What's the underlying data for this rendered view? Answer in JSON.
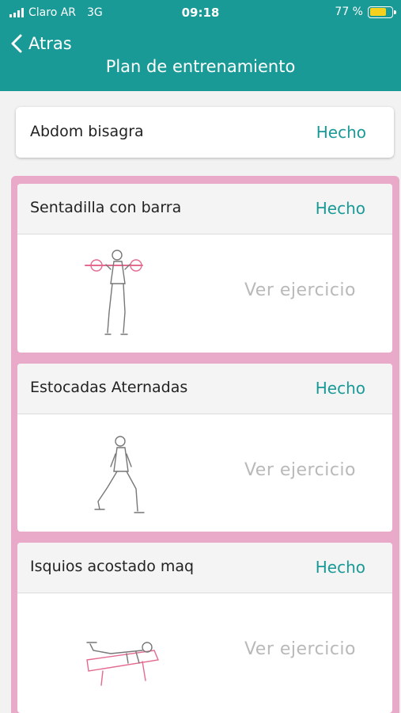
{
  "status_bar": {
    "carrier": "Claro AR",
    "network": "3G",
    "time": "09:18",
    "battery": "77 %",
    "battery_level": 0.77
  },
  "nav": {
    "back_label": "Atras",
    "title": "Plan de entrenamiento"
  },
  "items": [
    {
      "name": "Abdom bisagra",
      "status": "Hecho"
    },
    {
      "name": "Sentadilla con barra",
      "status": "Hecho",
      "view": "Ver ejercicio"
    },
    {
      "name": "Estocadas Aternadas",
      "status": "Hecho",
      "view": "Ver ejercicio"
    },
    {
      "name": "Isquios acostado maq",
      "status": "Hecho",
      "view": "Ver ejercicio"
    }
  ],
  "colors": {
    "accent": "#1a9a97",
    "highlight_border": "#e9a9c9",
    "muted_text": "#b9b9b9"
  }
}
